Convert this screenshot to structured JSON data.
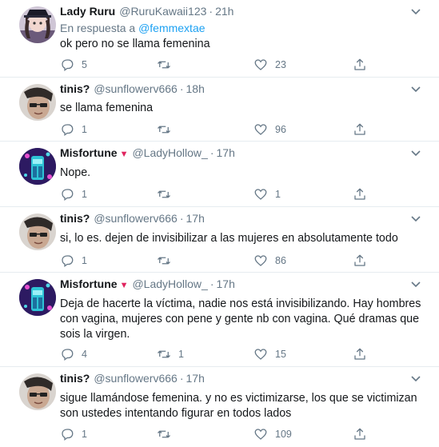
{
  "tweets": [
    {
      "name": "Lady Ruru",
      "handle": "@RuruKawaii123",
      "time": "21h",
      "reply_prefix": "En respuesta a",
      "reply_to": "@femmextae",
      "text": "ok pero no se llama femenina",
      "replies": "5",
      "retweets": "",
      "likes": "23"
    },
    {
      "name": "tinis?",
      "handle": "@sunflowerv666",
      "time": "18h",
      "text": "se llama femenina",
      "replies": "1",
      "retweets": "",
      "likes": "96"
    },
    {
      "name": "Misfortune",
      "name_badge": "▼",
      "handle": "@LadyHollow_",
      "time": "17h",
      "text": "Nope.",
      "replies": "1",
      "retweets": "",
      "likes": "1"
    },
    {
      "name": "tinis?",
      "handle": "@sunflowerv666",
      "time": "17h",
      "text": "si, lo es. dejen de invisibilizar a las mujeres en absolutamente todo",
      "replies": "1",
      "retweets": "",
      "likes": "86"
    },
    {
      "name": "Misfortune",
      "name_badge": "▼",
      "handle": "@LadyHollow_",
      "time": "17h",
      "text": "Deja de hacerte la víctima, nadie nos está invisibilizando. Hay hombres con vagina, mujeres con pene y gente nb con vagina. Qué dramas que sois la virgen.",
      "replies": "4",
      "retweets": "1",
      "likes": "15"
    },
    {
      "name": "tinis?",
      "handle": "@sunflowerv666",
      "time": "17h",
      "text": "sigue llamándose femenina. y no es victimizarse, los que se victimizan son ustedes intentando figurar en todos lados",
      "replies": "1",
      "retweets": "",
      "likes": "109"
    }
  ],
  "separator": "·",
  "colors": {
    "text": "#14171a",
    "secondary": "#657786",
    "link": "#1da1f2",
    "divider": "#e6ecf0",
    "badge": "#e0245e"
  },
  "icons": [
    "reply-icon",
    "retweet-icon",
    "like-icon",
    "share-icon",
    "caret-down-icon"
  ]
}
